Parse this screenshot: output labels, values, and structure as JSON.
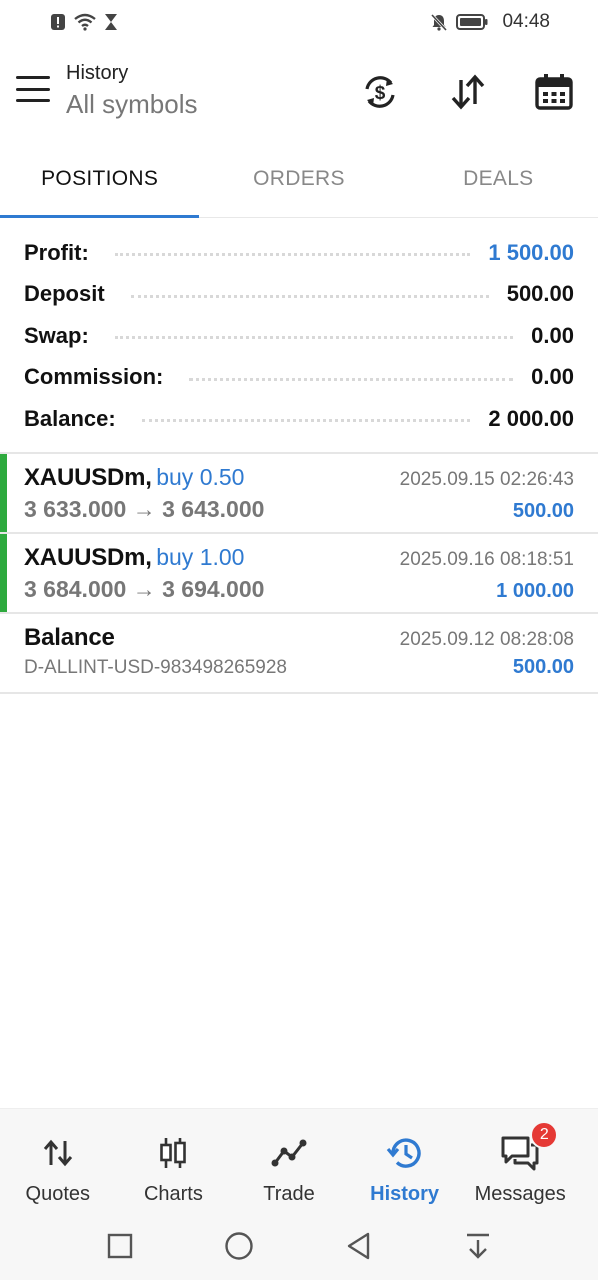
{
  "status_bar": {
    "time": "04:48"
  },
  "header": {
    "title": "History",
    "subtitle": "All symbols"
  },
  "tabs": [
    {
      "label": "POSITIONS",
      "active": true
    },
    {
      "label": "ORDERS",
      "active": false
    },
    {
      "label": "DEALS",
      "active": false
    }
  ],
  "summary": {
    "profit": {
      "label": "Profit:",
      "value": "1 500.00"
    },
    "deposit": {
      "label": "Deposit",
      "value": "500.00"
    },
    "swap": {
      "label": "Swap:",
      "value": "0.00"
    },
    "commission": {
      "label": "Commission:",
      "value": "0.00"
    },
    "balance": {
      "label": "Balance:",
      "value": "2 000.00"
    }
  },
  "positions": [
    {
      "symbol": "XAUUSDm,",
      "side": "buy 0.50",
      "time": "2025.09.15 02:26:43",
      "prices": "3 633.000 → 3 643.000",
      "profit": "500.00"
    },
    {
      "symbol": "XAUUSDm,",
      "side": "buy 1.00",
      "time": "2025.09.16 08:18:51",
      "prices": "3 684.000 → 3 694.000",
      "profit": "1 000.00"
    }
  ],
  "balance_entry": {
    "title": "Balance",
    "time": "2025.09.12 08:28:08",
    "ref": "D-ALLINT-USD-983498265928",
    "amount": "500.00"
  },
  "bottom_nav": {
    "quotes": "Quotes",
    "charts": "Charts",
    "trade": "Trade",
    "history": "History",
    "messages": "Messages",
    "messages_badge": "2"
  },
  "colors": {
    "accent": "#2f7ad1",
    "buy_marker": "#2eaa3e",
    "badge": "#e53935"
  }
}
